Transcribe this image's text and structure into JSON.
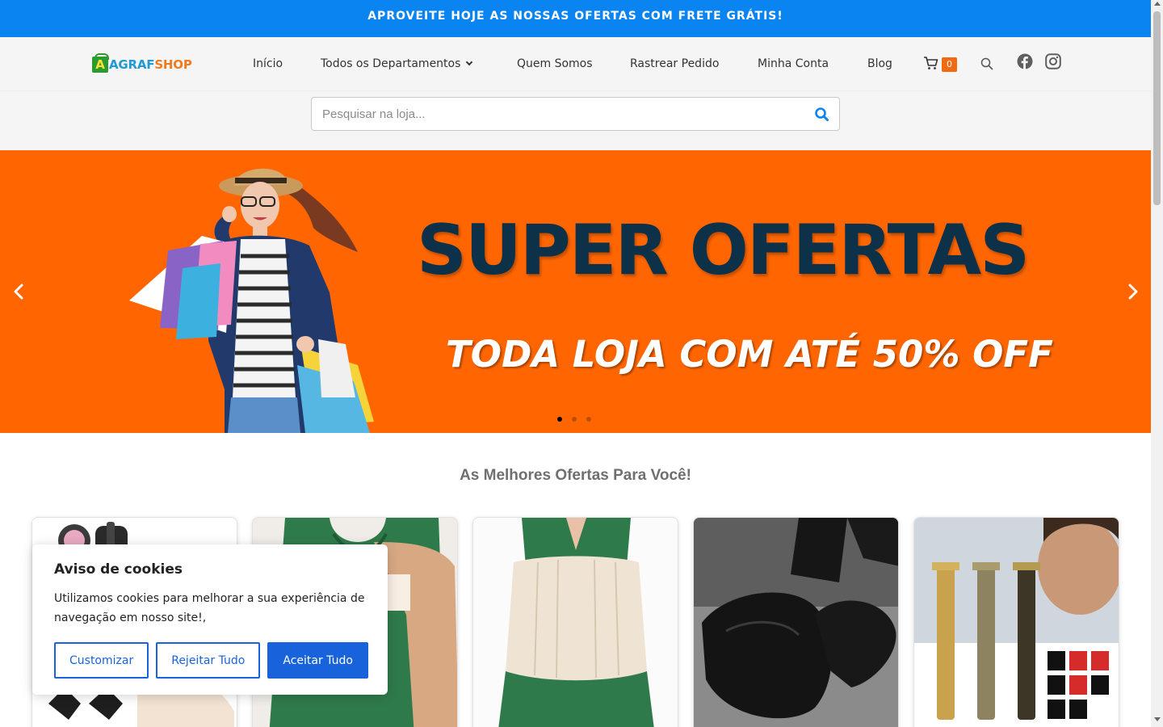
{
  "announcement": "APROVEITE HOJE AS NOSSAS OFERTAS COM FRETE GRÁTIS!",
  "logo": {
    "mark": "A",
    "part1": "AGRAF",
    "part2": "SHOP"
  },
  "nav": {
    "items": [
      {
        "label": "Início"
      },
      {
        "label": "Todos os Departamentos"
      },
      {
        "label": "Quem Somos"
      },
      {
        "label": "Rastrear Pedido"
      },
      {
        "label": "Minha Conta"
      },
      {
        "label": "Blog"
      }
    ],
    "cart_count": "0",
    "icons": [
      "cart-icon",
      "search-icon",
      "facebook-icon",
      "instagram-icon"
    ]
  },
  "search": {
    "placeholder": "Pesquisar na loja...",
    "value": ""
  },
  "banner": {
    "title": "SUPER OFERTAS",
    "subtitle": "TODA LOJA COM ATÉ 50% OFF",
    "slides": 3,
    "active_slide": 1,
    "background": "#ff6602"
  },
  "offers": {
    "title": "As Melhores Ofertas Para Você!",
    "cards": [
      {
        "image": "hair-dryer-product"
      },
      {
        "image": "green-bodysuit-product"
      },
      {
        "image": "waist-trainer-product"
      },
      {
        "image": "black-loafer-shoes-product"
      },
      {
        "image": "hair-trimmer-set-product"
      }
    ]
  },
  "cookie": {
    "title": "Aviso de cookies",
    "text": "Utilizamos cookies para melhorar a sua experiência de navegação em nosso site!,",
    "customize": "Customizar",
    "reject": "Rejeitar Tudo",
    "accept": "Aceitar Tudo"
  },
  "colors": {
    "accent": "#0a84f0",
    "banner": "#ff6602",
    "badge": "#f06a12",
    "cookie_button": "#1863dc"
  }
}
